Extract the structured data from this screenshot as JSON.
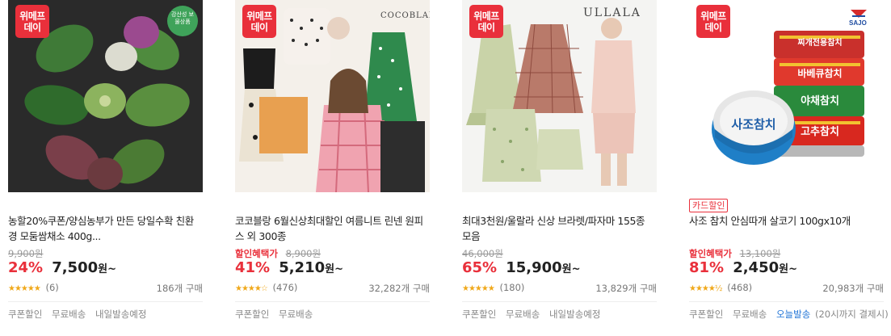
{
  "badge": {
    "line1": "위메프",
    "line2": "데이"
  },
  "products": [
    {
      "brand_text": "",
      "tag": "",
      "title": "농할20%쿠폰/양심농부가 만든 당일수확 친환경 모둠쌈채소 400g...",
      "price_label": "",
      "original_price": "9,900원",
      "discount_rate": "24%",
      "sale_price": "7,500",
      "price_suffix": "원~",
      "stars": "★★★★★",
      "rating": 5,
      "review_count": "(6)",
      "sold_count": "186개 구매",
      "shipping": [
        "쿠폰할인",
        "무료배송",
        "내일발송예정"
      ],
      "shipping_highlight": "",
      "shipping_note": "",
      "stamp_text": "강산성 보물상품"
    },
    {
      "brand_text": "COCOBLANC",
      "tag": "",
      "title": "코코블랑 6월신상최대할인 여름니트 린넨 원피스 외 300종",
      "price_label": "할인혜택가",
      "original_price": "8,900원",
      "discount_rate": "41%",
      "sale_price": "5,210",
      "price_suffix": "원~",
      "stars": "★★★★☆",
      "rating": 4,
      "review_count": "(476)",
      "sold_count": "32,282개 구매",
      "shipping": [
        "쿠폰할인",
        "무료배송"
      ],
      "shipping_highlight": "",
      "shipping_note": "",
      "stamp_text": ""
    },
    {
      "brand_text": "ULLALA",
      "tag": "",
      "title": "최대3천원/울랄라 신상 브라렛/파자마 155종 모음",
      "price_label": "",
      "original_price": "46,000원",
      "discount_rate": "65%",
      "sale_price": "15,900",
      "price_suffix": "원~",
      "stars": "★★★★★",
      "rating": 5,
      "review_count": "(180)",
      "sold_count": "13,829개 구매",
      "shipping": [
        "쿠폰할인",
        "무료배송",
        "내일발송예정"
      ],
      "shipping_highlight": "",
      "shipping_note": "",
      "stamp_text": ""
    },
    {
      "brand_text": "SAJO",
      "tag": "카드할인",
      "title": "사조 참치 안심따개 살코기 100gx10개",
      "price_label": "할인혜택가",
      "original_price": "13,100원",
      "discount_rate": "81%",
      "sale_price": "2,450",
      "price_suffix": "원~",
      "stars": "★★★★½",
      "rating": 4.5,
      "review_count": "(468)",
      "sold_count": "20,983개 구매",
      "shipping": [
        "쿠폰할인",
        "무료배송"
      ],
      "shipping_highlight": "오늘발송",
      "shipping_note": "(20시까지 결제시)",
      "stamp_text": "",
      "can_labels": [
        "찌개전용참치",
        "바베큐참치",
        "야채참치",
        "고추참치",
        "사조참치"
      ]
    }
  ],
  "colors": {
    "accent": "#e9303b",
    "star": "#f0a81a",
    "blue": "#1f73d6"
  }
}
